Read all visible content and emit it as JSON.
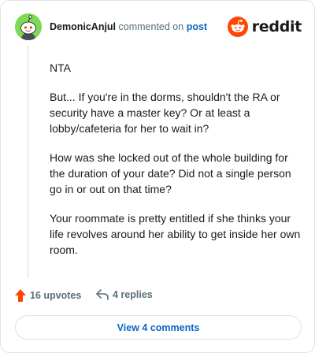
{
  "header": {
    "username": "DemonicAnjul",
    "verb": "commented on",
    "post_link": "post",
    "avatar_icon": "snoo-avatar-icon",
    "avatar_color": "#7ed957",
    "brand_icon": "reddit-logo-icon",
    "brand_text": "reddit",
    "brand_color": "#ff4500"
  },
  "comment": {
    "paragraphs": [
      "NTA",
      "But... If you're in the dorms, shouldn't the RA or security have a master key? Or at least a lobby/cafeteria for her to wait in?",
      "How was she locked out of the whole building for the duration of your date? Did not a single person go in or out on that time?",
      "Your roommate is pretty entitled if she thinks your life revolves around her ability to get inside her own room."
    ]
  },
  "actions": {
    "upvote_icon": "upvote-arrow-icon",
    "upvotes": "16 upvotes",
    "reply_icon": "reply-arrow-icon",
    "replies": "4 replies"
  },
  "footer": {
    "view_button": "View 4 comments"
  }
}
